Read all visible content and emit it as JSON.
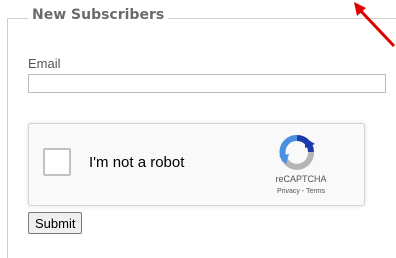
{
  "form": {
    "legend": "New Subscribers",
    "email_label": "Email",
    "email_value": "",
    "submit_label": "Submit"
  },
  "recaptcha": {
    "checkbox_label": "I'm not a robot",
    "brand": "reCAPTCHA",
    "privacy": "Privacy",
    "separator": " - ",
    "terms": "Terms",
    "icon": "recaptcha-logo-icon"
  },
  "annotation": {
    "icon": "red-arrow-icon",
    "color": "#e00000"
  },
  "colors": {
    "logo_blue": "#1c3aa9",
    "logo_light_blue": "#4a90e2",
    "logo_grey": "#b5b5b5"
  }
}
